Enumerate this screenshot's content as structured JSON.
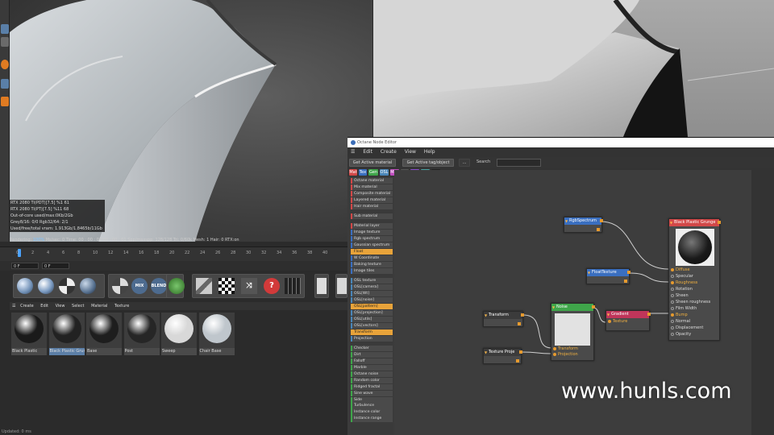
{
  "render_stats": {
    "lines": [
      "RTX 2080 Ti(PDT)[7.5]          %1      61",
      "RTX 2080 Ti(PT)[7.5]           %11     68",
      "Out-of-core used/max:0Kb/2Gb",
      "Grey8/16: 0/0           Rgb32/64: 2/1",
      "Used/free/total vram: 1.913Gb/1.8465b/11Gb"
    ],
    "render_bar_prefix": "Rendering: ",
    "render_percent": "100%",
    "render_bar_rest": " Ms/sec: 0    Time: 00 : 00 : 01/00 : 00 : 01    Spp/maxspp: 128/128    Tri: 0/60k    Mesh: 1    Hair: 0    RTX:on"
  },
  "timeline": {
    "ticks": [
      "0",
      "2",
      "4",
      "6",
      "8",
      "10",
      "12",
      "14",
      "16",
      "18",
      "20",
      "22",
      "24",
      "26",
      "28",
      "30",
      "32",
      "34",
      "36",
      "38",
      "40"
    ],
    "start_frame": "0 F",
    "current_frame": "0 F"
  },
  "toolbar_icons": {
    "mix_label": "MIX",
    "blend_label": "BLEND"
  },
  "material_manager": {
    "menu": [
      "Create",
      "Edit",
      "View",
      "Select",
      "Material",
      "Texture"
    ],
    "materials": [
      {
        "name": "Black Plastic",
        "ball": "#1a1a1a",
        "selected": false
      },
      {
        "name": "Black Plastic Grun",
        "ball": "#222222",
        "selected": true
      },
      {
        "name": "Base",
        "ball": "#1e1e1e",
        "selected": false
      },
      {
        "name": "Post",
        "ball": "#262626",
        "selected": false
      },
      {
        "name": "Sweep",
        "ball": "#d8d8d8",
        "selected": false
      },
      {
        "name": "Chair Base",
        "ball": "#bfc6cc",
        "selected": false
      }
    ],
    "status": "Updated: 0 ms"
  },
  "node_editor": {
    "title": "Octane Node Editor",
    "menu": [
      "Edit",
      "Create",
      "View",
      "Help"
    ],
    "buttons": {
      "get_active_material": "Get Active material",
      "get_active_tag": "Get Active tag/object",
      "dots": "...",
      "search_label": "Search"
    },
    "categories": [
      {
        "label": "Mat",
        "color": "#d24848"
      },
      {
        "label": "Tex",
        "color": "#3a6fc0"
      },
      {
        "label": "Gen",
        "color": "#3fa54a"
      },
      {
        "label": "OSL",
        "color": "#4a86b8"
      },
      {
        "label": "Map",
        "color": "#c04dbf"
      },
      {
        "label": "Oth",
        "color": "#555555"
      },
      {
        "label": "Ems",
        "color": "#8a4fd0"
      },
      {
        "label": "Med",
        "color": "#4aa3a3"
      },
      {
        "label": "C4D",
        "color": "#222222"
      }
    ],
    "node_list": [
      {
        "label": "Octane material",
        "color": "#d24848"
      },
      {
        "label": "Mix material",
        "color": "#d24848"
      },
      {
        "label": "Composite material",
        "color": "#d24848"
      },
      {
        "label": "Layered material",
        "color": "#d24848"
      },
      {
        "label": "Hair material",
        "color": "#d24848"
      },
      {
        "gap": true
      },
      {
        "label": "Sub material",
        "color": "#d24848"
      },
      {
        "gap": true
      },
      {
        "label": "Material layer",
        "color": "#d24848"
      },
      {
        "label": "Image texture",
        "color": "#3a6fc0"
      },
      {
        "label": "Rgb spectrum",
        "color": "#3a6fc0"
      },
      {
        "label": "Gaussian spectrum",
        "color": "#3a6fc0"
      },
      {
        "label": "Float",
        "color": "#e8a33a",
        "orange": true
      },
      {
        "label": "W Coordinate",
        "color": "#3a6fc0"
      },
      {
        "label": "Baking texture",
        "color": "#3a6fc0"
      },
      {
        "label": "Image tiles",
        "color": "#3a6fc0"
      },
      {
        "gap": true
      },
      {
        "label": "OSL texture",
        "color": "#4a86b8"
      },
      {
        "label": "OSL[camera]",
        "color": "#4a86b8"
      },
      {
        "label": "OSL[Wt]",
        "color": "#4a86b8"
      },
      {
        "label": "OSL[noise]",
        "color": "#4a86b8"
      },
      {
        "label": "OSL[pattern]",
        "color": "#e8a33a",
        "orange": true
      },
      {
        "label": "OSL[projection]",
        "color": "#4a86b8"
      },
      {
        "label": "OSL[utils]",
        "color": "#4a86b8"
      },
      {
        "label": "OSL[vectors]",
        "color": "#4a86b8"
      },
      {
        "label": "Transform",
        "color": "#e8a33a",
        "orange": true
      },
      {
        "label": "Projection",
        "color": "#4a86b8"
      },
      {
        "gap": true
      },
      {
        "label": "Checker",
        "color": "#3fa54a"
      },
      {
        "label": "Dirt",
        "color": "#3fa54a"
      },
      {
        "label": "Falloff",
        "color": "#3fa54a"
      },
      {
        "label": "Marble",
        "color": "#3fa54a"
      },
      {
        "label": "Octane noise",
        "color": "#3fa54a"
      },
      {
        "label": "Random color",
        "color": "#3fa54a"
      },
      {
        "label": "Ridged fractal",
        "color": "#3fa54a"
      },
      {
        "label": "Sine wave",
        "color": "#3fa54a"
      },
      {
        "label": "Side",
        "color": "#3fa54a"
      },
      {
        "label": "Turbulence",
        "color": "#3fa54a"
      },
      {
        "label": "Instance color",
        "color": "#3fa54a"
      },
      {
        "label": "Instance range",
        "color": "#3fa54a"
      }
    ],
    "nodes": {
      "rgb_spectrum": {
        "title": "RgbSpectrum",
        "color": "#3a6fc0"
      },
      "float_texture": {
        "title": "FloatTexture",
        "color": "#3a6fc0"
      },
      "transform": {
        "title": "Transform",
        "color": "#e8a33a"
      },
      "texture_proj": {
        "title": "Texture Proje",
        "color": "#e8a33a"
      },
      "noise": {
        "title": "Noise",
        "color": "#3fa54a",
        "ports": [
          "Transform",
          "Projection"
        ]
      },
      "gradient": {
        "title": "Gradient",
        "color": "#c0355a",
        "ports": [
          "Texture"
        ]
      },
      "material": {
        "title": "Black Plastic Grunge",
        "color": "#d24848",
        "ports": [
          {
            "label": "Diffuse",
            "active": true
          },
          {
            "label": "Specular",
            "active": false
          },
          {
            "label": "Roughness",
            "active": true
          },
          {
            "label": "Rotation",
            "active": false
          },
          {
            "label": "Sheen",
            "active": false
          },
          {
            "label": "Sheen roughness",
            "active": false
          },
          {
            "label": "Film Width",
            "active": false
          },
          {
            "label": "Bump",
            "active": true
          },
          {
            "label": "Normal",
            "active": false
          },
          {
            "label": "Displacement",
            "active": false
          },
          {
            "label": "Opacity",
            "active": false
          }
        ]
      }
    }
  },
  "watermark": "www.hunls.com"
}
